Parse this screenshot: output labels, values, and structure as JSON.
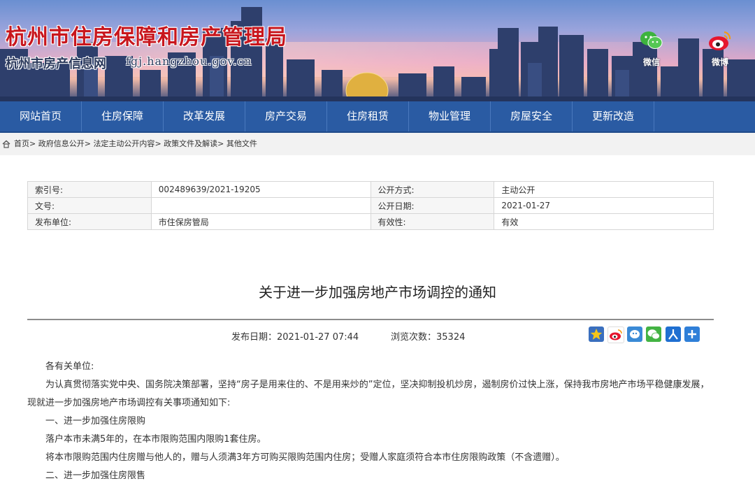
{
  "header": {
    "site_title": "杭州市住房保障和房产管理局",
    "site_sub": "杭州市房产信息网",
    "site_url": "fgj.hangzhou.gov.cn",
    "wechat_label": "微信",
    "weibo_label": "微博"
  },
  "nav": {
    "items": [
      "网站首页",
      "住房保障",
      "改革发展",
      "房产交易",
      "住房租赁",
      "物业管理",
      "房屋安全",
      "更新改造"
    ]
  },
  "breadcrumb": {
    "items": [
      "首页",
      "政府信息公开",
      "法定主动公开内容",
      "政策文件及解读",
      "其他文件"
    ],
    "separator": ">"
  },
  "info_table": {
    "row1": {
      "l1": "索引号:",
      "v1": "002489639/2021-19205",
      "l2": "公开方式:",
      "v2": "主动公开"
    },
    "row2": {
      "l1": "文号:",
      "v1": "",
      "l2": "公开日期:",
      "v2": "2021-01-27"
    },
    "row3": {
      "l1": "发布单位:",
      "v1": "市住保房管局",
      "l2": "有效性:",
      "v2": "有效"
    }
  },
  "article": {
    "title": "关于进一步加强房地产市场调控的通知",
    "publish_label": "发布日期：",
    "publish_value": "2021-01-27 07:44",
    "views_label": "浏览次数：",
    "views_value": "35324",
    "paragraphs": {
      "p1": "各有关单位:",
      "p2": "为认真贯彻落实党中央、国务院决策部署，坚持“房子是用来住的、不是用来炒的”定位，坚决抑制投机炒房，遏制房价过快上涨，保持我市房地产市场平稳健康发展，现就进一步加强房地产市场调控有关事项通知如下:",
      "p3": "一、进一步加强住房限购",
      "p4": "落户本市未满5年的，在本市限购范围内限购1套住房。",
      "p5": "将本市限购范围内住房赠与他人的，赠与人须满3年方可购买限购范围内住房；受赠人家庭须符合本市住房限购政策（不含遗赠）。",
      "p6": "二、进一步加强住房限售"
    }
  },
  "share_icons": [
    "favorite-icon",
    "weibo-share-icon",
    "qq-share-icon",
    "wechat-share-icon",
    "renren-share-icon",
    "more-share-icon"
  ],
  "colors": {
    "nav_bg": "#2a5ba3",
    "title_red": "#c8161d"
  }
}
